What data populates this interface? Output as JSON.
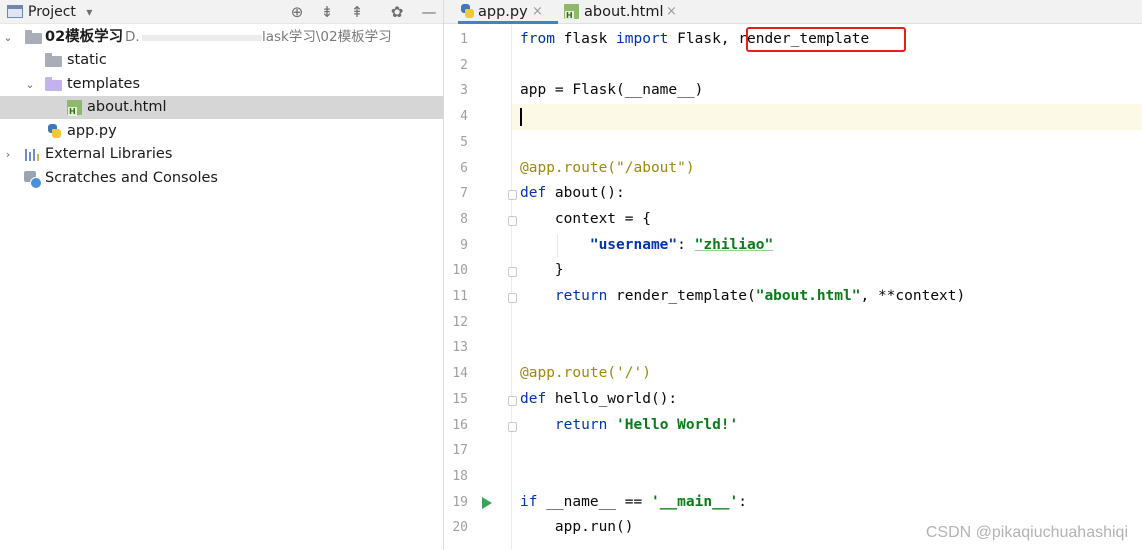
{
  "project_panel": {
    "toolbar": {
      "title": "Project",
      "dropdown_glyph": "▾",
      "icons": [
        "locate-icon",
        "expand-all-icon",
        "collapse-all-icon",
        "gear-icon",
        "hide-icon"
      ],
      "glyphs": {
        "locate": "⊕",
        "expand": "⇟",
        "collapse": "⇞",
        "gear": "✿",
        "hide": "—"
      }
    },
    "tree": {
      "root": {
        "name": "02模板学习",
        "path_prefix": "D.",
        "path_suffix": "lask学习\\02模板学习",
        "expanded": true
      },
      "items": [
        {
          "label": "static",
          "kind": "folder"
        },
        {
          "label": "templates",
          "kind": "folder",
          "expanded": true
        },
        {
          "label": "about.html",
          "kind": "html",
          "selected": true
        },
        {
          "label": "app.py",
          "kind": "python"
        },
        {
          "label": "External Libraries",
          "kind": "libraries",
          "expanded": false
        },
        {
          "label": "Scratches and Consoles",
          "kind": "scratches"
        }
      ]
    }
  },
  "editor": {
    "tabs": [
      {
        "label": "app.py",
        "active": true,
        "close": "×"
      },
      {
        "label": "about.html",
        "active": false,
        "close": "×"
      }
    ],
    "current_line": 4,
    "run_line": 19,
    "highlighted_token": "render_template",
    "lines": {
      "l1": {
        "from": "from",
        "mod": " flask ",
        "imp": "import",
        "rest": " Flask, ",
        "fn": "render_template"
      },
      "l3": {
        "text": "app = Flask(__name__)"
      },
      "l6": {
        "text": "@app.route(\"/about\")"
      },
      "l7": {
        "kw": "def",
        "rest": " about():"
      },
      "l8": {
        "text": "    context = {"
      },
      "l9": {
        "indent": "        ",
        "key": "\"username\"",
        "sep": ": ",
        "val": "\"zhiliao\""
      },
      "l10": {
        "text": "    }"
      },
      "l11": {
        "indent": "    ",
        "kw": "return",
        "mid": " render_template(",
        "str": "\"about.html\"",
        "rest": ", **context)"
      },
      "l14": {
        "text": "@app.route('/')"
      },
      "l15": {
        "kw": "def",
        "rest": " hello_world():"
      },
      "l16": {
        "indent": "    ",
        "kw": "return",
        "sp": " ",
        "str": "'Hello World!'"
      },
      "l19": {
        "kw": "if",
        "mid": " __name__ == ",
        "str": "'__main__'",
        "rest": ":"
      },
      "l20": {
        "text": "    app.run()"
      }
    }
  },
  "watermark": "CSDN @pikaqiuchuahashiqi"
}
